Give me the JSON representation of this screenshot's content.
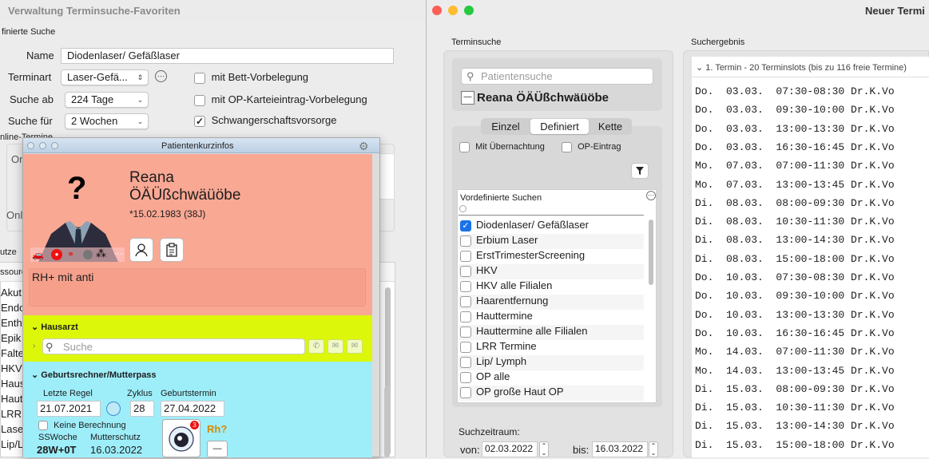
{
  "win_a": {
    "title": "Verwaltung Terminsuche-Favoriten",
    "section": "finierte Suche",
    "name_label": "Name",
    "name_value": "Diodenlaser/ Gefäßlaser",
    "terminart_label": "Terminart",
    "terminart_value": "Laser-Gefä...",
    "suche_ab_label": "Suche ab",
    "suche_ab_value": "224 Tage",
    "suche_fuer_label": "Suche für",
    "suche_fuer_value": "2 Wochen",
    "cb_bett": "mit Bett-Vorbelegung",
    "cb_op": "mit OP-Karteieintrag-Vorbelegung",
    "cb_schwanger": "Schwangerschaftsvorsorge",
    "online_termine": "nline-Termine",
    "on1": "On",
    "on2": "Onl",
    "nutzer": "utze",
    "ressource": "ssourc",
    "left_list": [
      "Akut",
      "Endo",
      "Enth",
      "Epik",
      "Falte",
      "HKV",
      "Haus",
      "Haut",
      "LRR",
      "Lase",
      "Lip/L"
    ]
  },
  "panel": {
    "title": "Patientenkurzinfos",
    "first_name": "Reana",
    "last_name": "ÖÄÜßchwäüöbe",
    "birth": "*15.02.1983 (38J)",
    "note": "RH+ mit anti",
    "hausarzt_title": "Hausarzt",
    "search_placeholder": "Suche",
    "geburt_title": "Geburtsrechner/Mutterpass",
    "letzte_regel_label": "Letzte Regel",
    "letzte_regel_value": "21.07.2021",
    "zyklus_label": "Zyklus",
    "zyklus_value": "28",
    "geburtstermin_label": "Geburtstermin",
    "geburtstermin_value": "27.04.2022",
    "keine_berechnung": "Keine Berechnung",
    "ssw_label": "SSWoche",
    "ssw_value": "28W+0T",
    "mutterschutz_label": "Mutterschutz",
    "mutterschutz_value": "16.03.2022",
    "rh_label": "Rh?",
    "minus_label": "—",
    "badge_count": "3"
  },
  "win_b": {
    "title": "Neuer Termi",
    "terminsuche_label": "Terminsuche",
    "suchergebnis_label": "Suchergebnis",
    "patient_placeholder": "Patientensuche",
    "patient_name": "Reana ÖÄÜßchwäüöbe",
    "minus_label": "—",
    "tabs": [
      "Einzel",
      "Definiert",
      "Kette"
    ],
    "cb_uebernachtung": "Mit Übernachtung",
    "cb_op_eintrag": "OP-Eintrag",
    "vordef_label": "Vordefinierte Suchen",
    "vordef_items": [
      {
        "label": "Diodenlaser/ Gefäßlaser",
        "checked": true
      },
      {
        "label": "Erbium Laser",
        "checked": false
      },
      {
        "label": "ErstTrimesterScreening",
        "checked": false
      },
      {
        "label": "HKV",
        "checked": false
      },
      {
        "label": "HKV alle Filialen",
        "checked": false
      },
      {
        "label": "Haarentfernung",
        "checked": false
      },
      {
        "label": "Hauttermine",
        "checked": false
      },
      {
        "label": "Hauttermine alle Filialen",
        "checked": false
      },
      {
        "label": "LRR Termine",
        "checked": false
      },
      {
        "label": "Lip/ Lymph",
        "checked": false
      },
      {
        "label": "OP alle",
        "checked": false
      },
      {
        "label": "OP große Haut OP",
        "checked": false
      }
    ],
    "suchzeitraum_label": "Suchzeitraum:",
    "von_label": "von:",
    "von_value": "02.03.2022",
    "bis_label": "bis:",
    "bis_value": "16.03.2022",
    "result_header": "1. Termin - 20 Terminslots (bis zu 116 freie Termine)",
    "results": [
      "Do.  03.03.  07:30-08:30 Dr.K.Vo",
      "Do.  03.03.  09:30-10:00 Dr.K.Vo",
      "Do.  03.03.  13:00-13:30 Dr.K.Vo",
      "Do.  03.03.  16:30-16:45 Dr.K.Vo",
      "Mo.  07.03.  07:00-11:30 Dr.K.Vo",
      "Mo.  07.03.  13:00-13:45 Dr.K.Vo",
      "Di.  08.03.  08:00-09:30 Dr.K.Vo",
      "Di.  08.03.  10:30-11:30 Dr.K.Vo",
      "Di.  08.03.  13:00-14:30 Dr.K.Vo",
      "Di.  08.03.  15:00-18:00 Dr.K.Vo",
      "Do.  10.03.  07:30-08:30 Dr.K.Vo",
      "Do.  10.03.  09:30-10:00 Dr.K.Vo",
      "Do.  10.03.  13:00-13:30 Dr.K.Vo",
      "Do.  10.03.  16:30-16:45 Dr.K.Vo",
      "Mo.  14.03.  07:00-11:30 Dr.K.Vo",
      "Mo.  14.03.  13:00-13:45 Dr.K.Vo",
      "Di.  15.03.  08:00-09:30 Dr.K.Vo",
      "Di.  15.03.  10:30-11:30 Dr.K.Vo",
      "Di.  15.03.  13:00-14:30 Dr.K.Vo",
      "Di.  15.03.  15:00-18:00 Dr.K.Vo"
    ]
  },
  "colors": {
    "panel_salmon": "#f9a894",
    "panel_lime": "#dcf70a",
    "panel_cyan": "#9eeefa",
    "titlebar_blue": "#c9dcee",
    "accent_blue": "#1a73e8"
  }
}
